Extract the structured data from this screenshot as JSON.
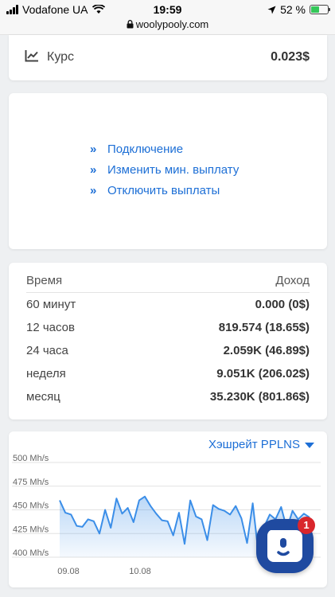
{
  "status_bar": {
    "carrier": "Vodafone UA",
    "time": "19:59",
    "url": "woolypooly.com",
    "battery": "52 %"
  },
  "rate": {
    "icon": "trend-chart-icon",
    "label": "Курс",
    "value": "0.023$"
  },
  "links": [
    {
      "label": "Подключение"
    },
    {
      "label": "Изменить мин. выплату"
    },
    {
      "label": "Отключить выплаты"
    }
  ],
  "income": {
    "col_time": "Время",
    "col_income": "Доход",
    "rows": [
      {
        "period": "60 минут",
        "amount": "0.000 (0$)"
      },
      {
        "period": "12 часов",
        "amount": "819.574 (18.65$)"
      },
      {
        "period": "24 часа",
        "amount": "2.059K (46.89$)"
      },
      {
        "period": "неделя",
        "amount": "9.051K (206.02$)"
      },
      {
        "period": "месяц",
        "amount": "35.230K (801.86$)"
      }
    ]
  },
  "hashrate_select": "Хэшрейт PPLNS",
  "chart_data": {
    "type": "area",
    "y_ticks": [
      "500 Mh/s",
      "475 Mh/s",
      "450 Mh/s",
      "425 Mh/s",
      "400 Mh/s"
    ],
    "x_ticks": [
      "09.08",
      "10.08"
    ],
    "ylim": [
      400,
      500
    ],
    "color": "#3b8ee8",
    "values": [
      460,
      447,
      445,
      433,
      432,
      440,
      438,
      425,
      450,
      431,
      462,
      446,
      452,
      437,
      460,
      464,
      454,
      446,
      439,
      438,
      423,
      447,
      414,
      460,
      443,
      440,
      418,
      455,
      451,
      449,
      445,
      454,
      441,
      415,
      457,
      404,
      432,
      445,
      440,
      453,
      430,
      449,
      440,
      446,
      442
    ]
  },
  "chat": {
    "badge": "1",
    "icon": "chat-bubble-icon"
  },
  "colors": {
    "accent": "#1d6fd6",
    "chat": "#1f4aa0",
    "badge": "#d9262c"
  }
}
